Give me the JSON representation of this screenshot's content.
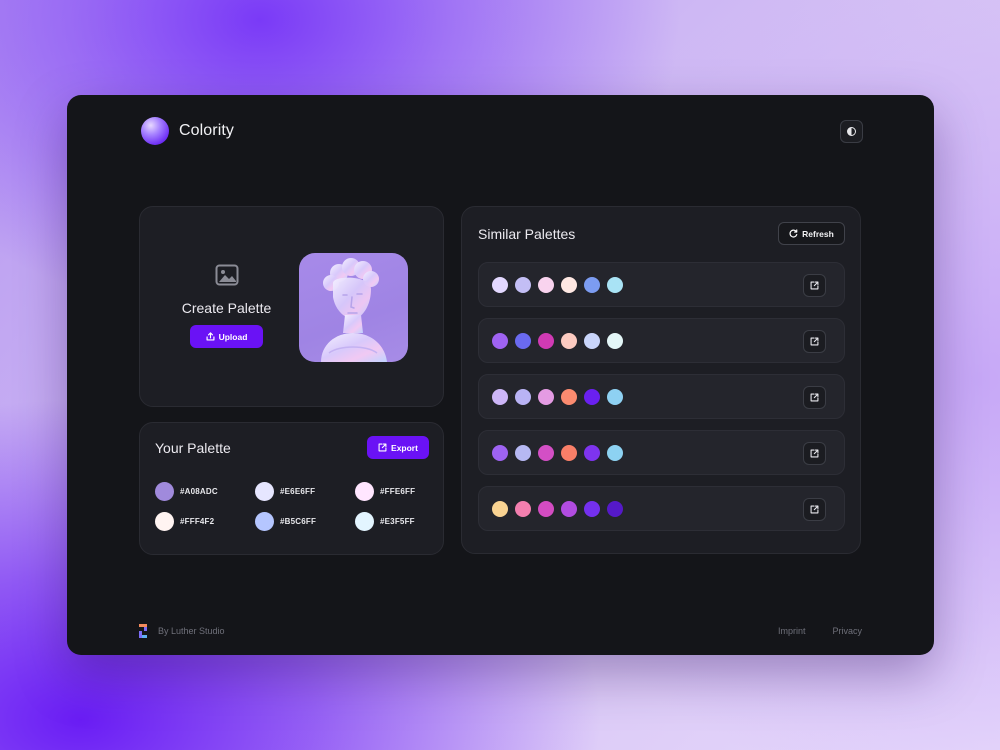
{
  "brand": {
    "name": "Colority"
  },
  "create": {
    "title": "Create Palette",
    "upload_label": "Upload"
  },
  "your_palette": {
    "title": "Your Palette",
    "export_label": "Export",
    "colors": [
      {
        "hex": "#A08ADC",
        "label": "#A08ADC"
      },
      {
        "hex": "#E6E6FF",
        "label": "#E6E6FF"
      },
      {
        "hex": "#FFE6FF",
        "label": "#FFE6FF"
      },
      {
        "hex": "#FFF4F2",
        "label": "#FFF4F2"
      },
      {
        "hex": "#B5C6FF",
        "label": "#B5C6FF"
      },
      {
        "hex": "#E3F5FF",
        "label": "#E3F5FF"
      }
    ]
  },
  "similar": {
    "title": "Similar Palettes",
    "refresh_label": "Refresh",
    "palettes": [
      [
        "#E3D8FF",
        "#C3BEF5",
        "#F9D3EE",
        "#FFE8E3",
        "#7C9CF1",
        "#A9E3F5"
      ],
      [
        "#9F63F2",
        "#6A6AF0",
        "#D03AB4",
        "#FCCBC1",
        "#C9D5FB",
        "#E3F6F7"
      ],
      [
        "#CDB6F8",
        "#B9B3F5",
        "#E49BE3",
        "#FB8B70",
        "#6A20F0",
        "#8ED1F3"
      ],
      [
        "#9E63F2",
        "#B6B8F3",
        "#D34FC5",
        "#F97F68",
        "#7E34EE",
        "#8DD2F2"
      ],
      [
        "#F9D392",
        "#F37FAF",
        "#D34CC2",
        "#B24CE1",
        "#7430EE",
        "#5519C9"
      ]
    ]
  },
  "footer": {
    "credit": "By Luther Studio",
    "imprint": "Imprint",
    "privacy": "Privacy"
  },
  "colors": {
    "accent": "#6A12F5",
    "window_bg": "#141519",
    "card_bg": "#1D1E24"
  }
}
